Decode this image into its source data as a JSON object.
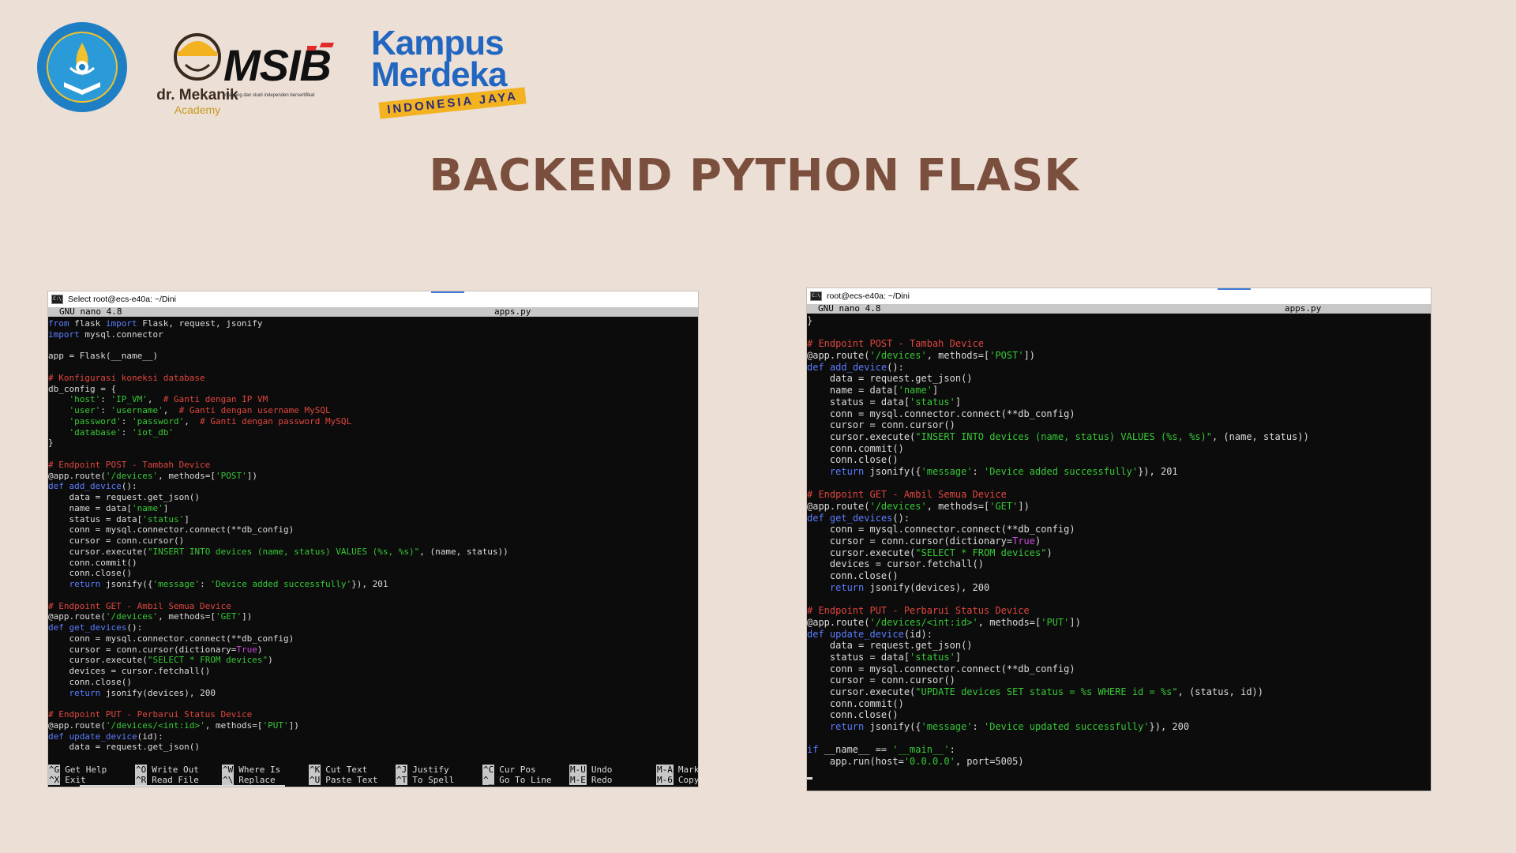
{
  "header": {
    "logos": [
      {
        "name": "tut-wuri-handayani-seal",
        "text": "TUT WURI HANDAYANI"
      },
      {
        "name": "dr-mekanik-logo",
        "text": "dr. Mekanik",
        "subtext": "Academy"
      },
      {
        "name": "msib-logo",
        "text": "MSIB",
        "tagline": "magang dan studi independen bersertifikat"
      },
      {
        "name": "kampus-merdeka-logo",
        "line1": "Kampus",
        "line2": "Merdeka",
        "badge": "INDONESIA JAYA"
      }
    ]
  },
  "title": "BACKEND PYTHON FLASK",
  "colors": {
    "background": "#ecdfd6",
    "title": "#7b4f3d",
    "terminal_bg": "#0c0c0c",
    "keyword": "#5b7cff",
    "comment": "#e0463f",
    "string": "#37c837",
    "builtin": "#c64bd6"
  },
  "left_window": {
    "title": "Select root@ecs-e40a: ~/Dini",
    "nano_version": "GNU nano 4.8",
    "file_name": "apps.py",
    "code_lines": [
      [
        [
          "kw",
          "from"
        ],
        [
          "t",
          " flask "
        ],
        [
          "kw",
          "import"
        ],
        [
          "t",
          " Flask, request, jsonify"
        ]
      ],
      [
        [
          "kw",
          "import"
        ],
        [
          "t",
          " mysql.connector"
        ]
      ],
      [],
      [
        [
          "t",
          "app = Flask(__name__)"
        ]
      ],
      [],
      [
        [
          "cm",
          "# Konfigurasi koneksi database"
        ]
      ],
      [
        [
          "t",
          "db_config = {"
        ]
      ],
      [
        [
          "t",
          "    "
        ],
        [
          "st",
          "'host'"
        ],
        [
          "t",
          ": "
        ],
        [
          "st",
          "'IP_VM'"
        ],
        [
          "t",
          ",  "
        ],
        [
          "cm",
          "# Ganti dengan IP VM"
        ]
      ],
      [
        [
          "t",
          "    "
        ],
        [
          "st",
          "'user'"
        ],
        [
          "t",
          ": "
        ],
        [
          "st",
          "'username'"
        ],
        [
          "t",
          ",  "
        ],
        [
          "cm",
          "# Ganti dengan username MySQL"
        ]
      ],
      [
        [
          "t",
          "    "
        ],
        [
          "st",
          "'password'"
        ],
        [
          "t",
          ": "
        ],
        [
          "st",
          "'password'"
        ],
        [
          "t",
          ",  "
        ],
        [
          "cm",
          "# Ganti dengan password MySQL"
        ]
      ],
      [
        [
          "t",
          "    "
        ],
        [
          "st",
          "'database'"
        ],
        [
          "t",
          ": "
        ],
        [
          "st",
          "'iot_db'"
        ]
      ],
      [
        [
          "t",
          "}"
        ]
      ],
      [],
      [
        [
          "cm",
          "# Endpoint POST - Tambah Device"
        ]
      ],
      [
        [
          "t",
          "@app.route("
        ],
        [
          "st",
          "'/devices'"
        ],
        [
          "t",
          ", methods=["
        ],
        [
          "st",
          "'POST'"
        ],
        [
          "t",
          "])"
        ]
      ],
      [
        [
          "kw",
          "def"
        ],
        [
          "t",
          " "
        ],
        [
          "kw",
          "add_device"
        ],
        [
          "t",
          "():"
        ]
      ],
      [
        [
          "t",
          "    data = request.get_json()"
        ]
      ],
      [
        [
          "t",
          "    name = data["
        ],
        [
          "st",
          "'name'"
        ],
        [
          "t",
          "]"
        ]
      ],
      [
        [
          "t",
          "    status = data["
        ],
        [
          "st",
          "'status'"
        ],
        [
          "t",
          "]"
        ]
      ],
      [
        [
          "t",
          "    conn = mysql.connector.connect(**db_config)"
        ]
      ],
      [
        [
          "t",
          "    cursor = conn.cursor()"
        ]
      ],
      [
        [
          "t",
          "    cursor.execute("
        ],
        [
          "st",
          "\"INSERT INTO devices (name, status) VALUES (%s, %s)\""
        ],
        [
          "t",
          ", (name, status))"
        ]
      ],
      [
        [
          "t",
          "    conn.commit()"
        ]
      ],
      [
        [
          "t",
          "    conn.close()"
        ]
      ],
      [
        [
          "t",
          "    "
        ],
        [
          "kw",
          "return"
        ],
        [
          "t",
          " jsonify({"
        ],
        [
          "st",
          "'message'"
        ],
        [
          "t",
          ": "
        ],
        [
          "st",
          "'Device added successfully'"
        ],
        [
          "t",
          "}), 201"
        ]
      ],
      [],
      [
        [
          "cm",
          "# Endpoint GET - Ambil Semua Device"
        ]
      ],
      [
        [
          "t",
          "@app.route("
        ],
        [
          "st",
          "'/devices'"
        ],
        [
          "t",
          ", methods=["
        ],
        [
          "st",
          "'GET'"
        ],
        [
          "t",
          "])"
        ]
      ],
      [
        [
          "kw",
          "def"
        ],
        [
          "t",
          " "
        ],
        [
          "kw",
          "get_devices"
        ],
        [
          "t",
          "():"
        ]
      ],
      [
        [
          "t",
          "    conn = mysql.connector.connect(**db_config)"
        ]
      ],
      [
        [
          "t",
          "    cursor = conn.cursor(dictionary="
        ],
        [
          "bi",
          "True"
        ],
        [
          "t",
          ")"
        ]
      ],
      [
        [
          "t",
          "    cursor.execute("
        ],
        [
          "st",
          "\"SELECT * FROM devices\""
        ],
        [
          "t",
          ")"
        ]
      ],
      [
        [
          "t",
          "    devices = cursor.fetchall()"
        ]
      ],
      [
        [
          "t",
          "    conn.close()"
        ]
      ],
      [
        [
          "t",
          "    "
        ],
        [
          "kw",
          "return"
        ],
        [
          "t",
          " jsonify(devices), 200"
        ]
      ],
      [],
      [
        [
          "cm",
          "# Endpoint PUT - Perbarui Status Device"
        ]
      ],
      [
        [
          "t",
          "@app.route("
        ],
        [
          "st",
          "'/devices/<int:id>'"
        ],
        [
          "t",
          ", methods=["
        ],
        [
          "st",
          "'PUT'"
        ],
        [
          "t",
          "])"
        ]
      ],
      [
        [
          "kw",
          "def"
        ],
        [
          "t",
          " "
        ],
        [
          "kw",
          "update_device"
        ],
        [
          "t",
          "(id):"
        ]
      ],
      [
        [
          "t",
          "    data = request.get_json()"
        ]
      ]
    ],
    "shortcuts": [
      {
        "key": "^G",
        "label": "Get Help"
      },
      {
        "key": "^O",
        "label": "Write Out"
      },
      {
        "key": "^W",
        "label": "Where Is"
      },
      {
        "key": "^K",
        "label": "Cut Text"
      },
      {
        "key": "^J",
        "label": "Justify"
      },
      {
        "key": "^C",
        "label": "Cur Pos"
      },
      {
        "key": "M-U",
        "label": "Undo"
      },
      {
        "key": "M-A",
        "label": "Mark"
      },
      {
        "key": "^X",
        "label": "Exit"
      },
      {
        "key": "^R",
        "label": "Read File"
      },
      {
        "key": "^\\",
        "label": "Replace"
      },
      {
        "key": "^U",
        "label": "Paste Text"
      },
      {
        "key": "^T",
        "label": "To Spell"
      },
      {
        "key": "^_",
        "label": "Go To Line"
      },
      {
        "key": "M-E",
        "label": "Redo"
      },
      {
        "key": "M-6",
        "label": "Copy"
      }
    ]
  },
  "right_window": {
    "title": "root@ecs-e40a: ~/Dini",
    "nano_version": "GNU nano 4.8",
    "file_name": "apps.py",
    "code_lines": [
      [
        [
          "t",
          "}"
        ]
      ],
      [],
      [
        [
          "cm",
          "# Endpoint POST - Tambah Device"
        ]
      ],
      [
        [
          "t",
          "@app.route("
        ],
        [
          "st",
          "'/devices'"
        ],
        [
          "t",
          ", methods=["
        ],
        [
          "st",
          "'POST'"
        ],
        [
          "t",
          "])"
        ]
      ],
      [
        [
          "kw",
          "def"
        ],
        [
          "t",
          " "
        ],
        [
          "kw",
          "add_device"
        ],
        [
          "t",
          "():"
        ]
      ],
      [
        [
          "t",
          "    data = request.get_json()"
        ]
      ],
      [
        [
          "t",
          "    name = data["
        ],
        [
          "st",
          "'name'"
        ],
        [
          "t",
          "]"
        ]
      ],
      [
        [
          "t",
          "    status = data["
        ],
        [
          "st",
          "'status'"
        ],
        [
          "t",
          "]"
        ]
      ],
      [
        [
          "t",
          "    conn = mysql.connector.connect(**db_config)"
        ]
      ],
      [
        [
          "t",
          "    cursor = conn.cursor()"
        ]
      ],
      [
        [
          "t",
          "    cursor.execute("
        ],
        [
          "st",
          "\"INSERT INTO devices (name, status) VALUES (%s, %s)\""
        ],
        [
          "t",
          ", (name, status))"
        ]
      ],
      [
        [
          "t",
          "    conn.commit()"
        ]
      ],
      [
        [
          "t",
          "    conn.close()"
        ]
      ],
      [
        [
          "t",
          "    "
        ],
        [
          "kw",
          "return"
        ],
        [
          "t",
          " jsonify({"
        ],
        [
          "st",
          "'message'"
        ],
        [
          "t",
          ": "
        ],
        [
          "st",
          "'Device added successfully'"
        ],
        [
          "t",
          "}), 201"
        ]
      ],
      [],
      [
        [
          "cm",
          "# Endpoint GET - Ambil Semua Device"
        ]
      ],
      [
        [
          "t",
          "@app.route("
        ],
        [
          "st",
          "'/devices'"
        ],
        [
          "t",
          ", methods=["
        ],
        [
          "st",
          "'GET'"
        ],
        [
          "t",
          "])"
        ]
      ],
      [
        [
          "kw",
          "def"
        ],
        [
          "t",
          " "
        ],
        [
          "kw",
          "get_devices"
        ],
        [
          "t",
          "():"
        ]
      ],
      [
        [
          "t",
          "    conn = mysql.connector.connect(**db_config)"
        ]
      ],
      [
        [
          "t",
          "    cursor = conn.cursor(dictionary="
        ],
        [
          "bi",
          "True"
        ],
        [
          "t",
          ")"
        ]
      ],
      [
        [
          "t",
          "    cursor.execute("
        ],
        [
          "st",
          "\"SELECT * FROM devices\""
        ],
        [
          "t",
          ")"
        ]
      ],
      [
        [
          "t",
          "    devices = cursor.fetchall()"
        ]
      ],
      [
        [
          "t",
          "    conn.close()"
        ]
      ],
      [
        [
          "t",
          "    "
        ],
        [
          "kw",
          "return"
        ],
        [
          "t",
          " jsonify(devices), 200"
        ]
      ],
      [],
      [
        [
          "cm",
          "# Endpoint PUT - Perbarui Status Device"
        ]
      ],
      [
        [
          "t",
          "@app.route("
        ],
        [
          "st",
          "'/devices/<int:id>'"
        ],
        [
          "t",
          ", methods=["
        ],
        [
          "st",
          "'PUT'"
        ],
        [
          "t",
          "])"
        ]
      ],
      [
        [
          "kw",
          "def"
        ],
        [
          "t",
          " "
        ],
        [
          "kw",
          "update_device"
        ],
        [
          "t",
          "(id):"
        ]
      ],
      [
        [
          "t",
          "    data = request.get_json()"
        ]
      ],
      [
        [
          "t",
          "    status = data["
        ],
        [
          "st",
          "'status'"
        ],
        [
          "t",
          "]"
        ]
      ],
      [
        [
          "t",
          "    conn = mysql.connector.connect(**db_config)"
        ]
      ],
      [
        [
          "t",
          "    cursor = conn.cursor()"
        ]
      ],
      [
        [
          "t",
          "    cursor.execute("
        ],
        [
          "st",
          "\"UPDATE devices SET status = %s WHERE id = %s\""
        ],
        [
          "t",
          ", (status, id))"
        ]
      ],
      [
        [
          "t",
          "    conn.commit()"
        ]
      ],
      [
        [
          "t",
          "    conn.close()"
        ]
      ],
      [
        [
          "t",
          "    "
        ],
        [
          "kw",
          "return"
        ],
        [
          "t",
          " jsonify({"
        ],
        [
          "st",
          "'message'"
        ],
        [
          "t",
          ": "
        ],
        [
          "st",
          "'Device updated successfully'"
        ],
        [
          "t",
          "}), 200"
        ]
      ],
      [],
      [
        [
          "kw",
          "if"
        ],
        [
          "t",
          " __name__ == "
        ],
        [
          "st",
          "'__main__'"
        ],
        [
          "t",
          ":"
        ]
      ],
      [
        [
          "t",
          "    app.run(host="
        ],
        [
          "st",
          "'0.0.0.0'"
        ],
        [
          "t",
          ", port=5005)"
        ]
      ],
      [
        [
          "cursor",
          ""
        ]
      ]
    ]
  }
}
